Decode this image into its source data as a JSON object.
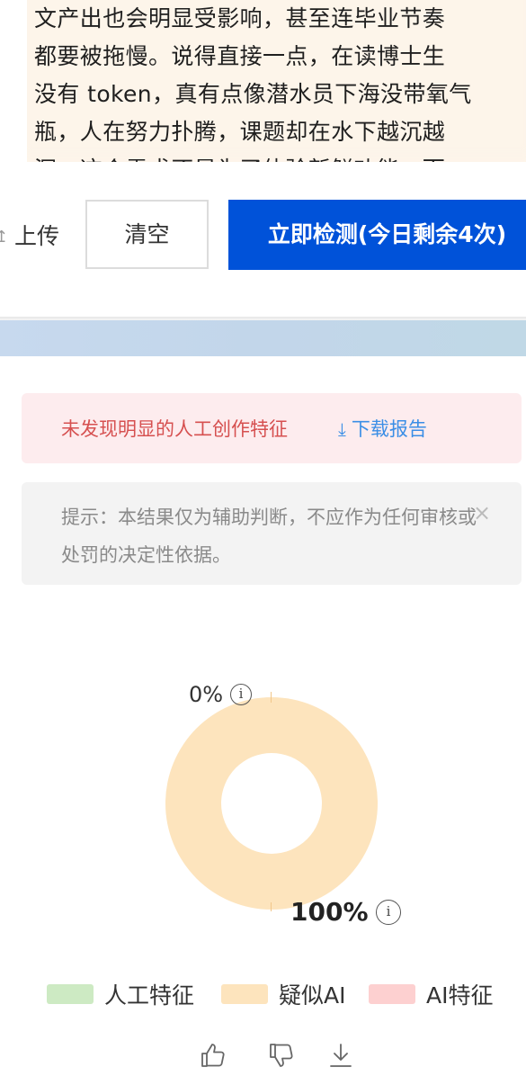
{
  "input_text": {
    "lines": [
      "文产出也会明显受影响，甚至连毕业节奏",
      "都要被拖慢。说得直接一点，在读博士生",
      "没有 token，真有点像潜水员下海没带氧气",
      "瓶，人在努力扑腾，课题却在水下越沉越",
      "深，这个需求不是为了体验新鲜功能，而"
    ]
  },
  "toolbar": {
    "upload_label": "上传",
    "clear_label": "清空",
    "detect_label": "立即检测(今日剩余4次)"
  },
  "result": {
    "status_text": "未发现明显的人工创作特征",
    "download_label": "下载报告"
  },
  "hint": {
    "text": "提示：本结果仅为辅助判断，不应作为任何审核或处罚的决定性依据。",
    "close_symbol": "×"
  },
  "chart_data": {
    "type": "pie",
    "categories": [
      "人工特征",
      "疑似AI",
      "AI特征"
    ],
    "values": [
      0,
      100,
      0
    ],
    "colors": [
      "#cdeac3",
      "#fde4bd",
      "#fdd0d0"
    ],
    "labels": [
      "0%",
      "100%"
    ],
    "legend_position": "bottom"
  },
  "icons": {
    "info": "i",
    "like": "thumbs-up-icon",
    "dislike": "thumbs-down-icon",
    "download": "download-icon"
  }
}
